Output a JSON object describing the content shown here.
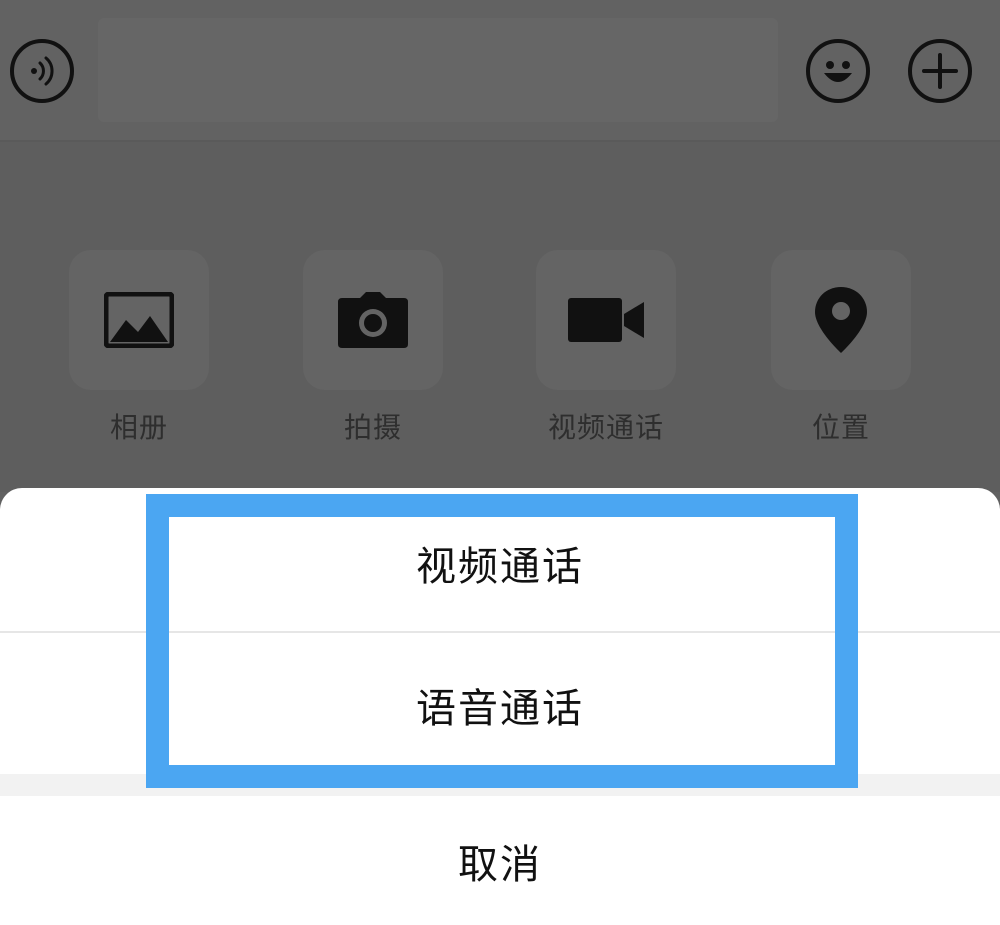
{
  "input_bar": {
    "voice_icon": "voice-icon",
    "emoji_icon": "emoji-icon",
    "plus_icon": "plus-icon",
    "input_value": ""
  },
  "panel": {
    "tiles": [
      {
        "label": "相册",
        "icon": "photo-icon"
      },
      {
        "label": "拍摄",
        "icon": "camera-icon"
      },
      {
        "label": "视频通话",
        "icon": "video-icon"
      },
      {
        "label": "位置",
        "icon": "location-icon"
      }
    ]
  },
  "sheet": {
    "video_call": "视频通话",
    "voice_call": "语音通话",
    "cancel": "取消"
  },
  "colors": {
    "overlay": "#616161",
    "highlight": "#4ba6f2",
    "sheet_bg": "#ffffff"
  }
}
